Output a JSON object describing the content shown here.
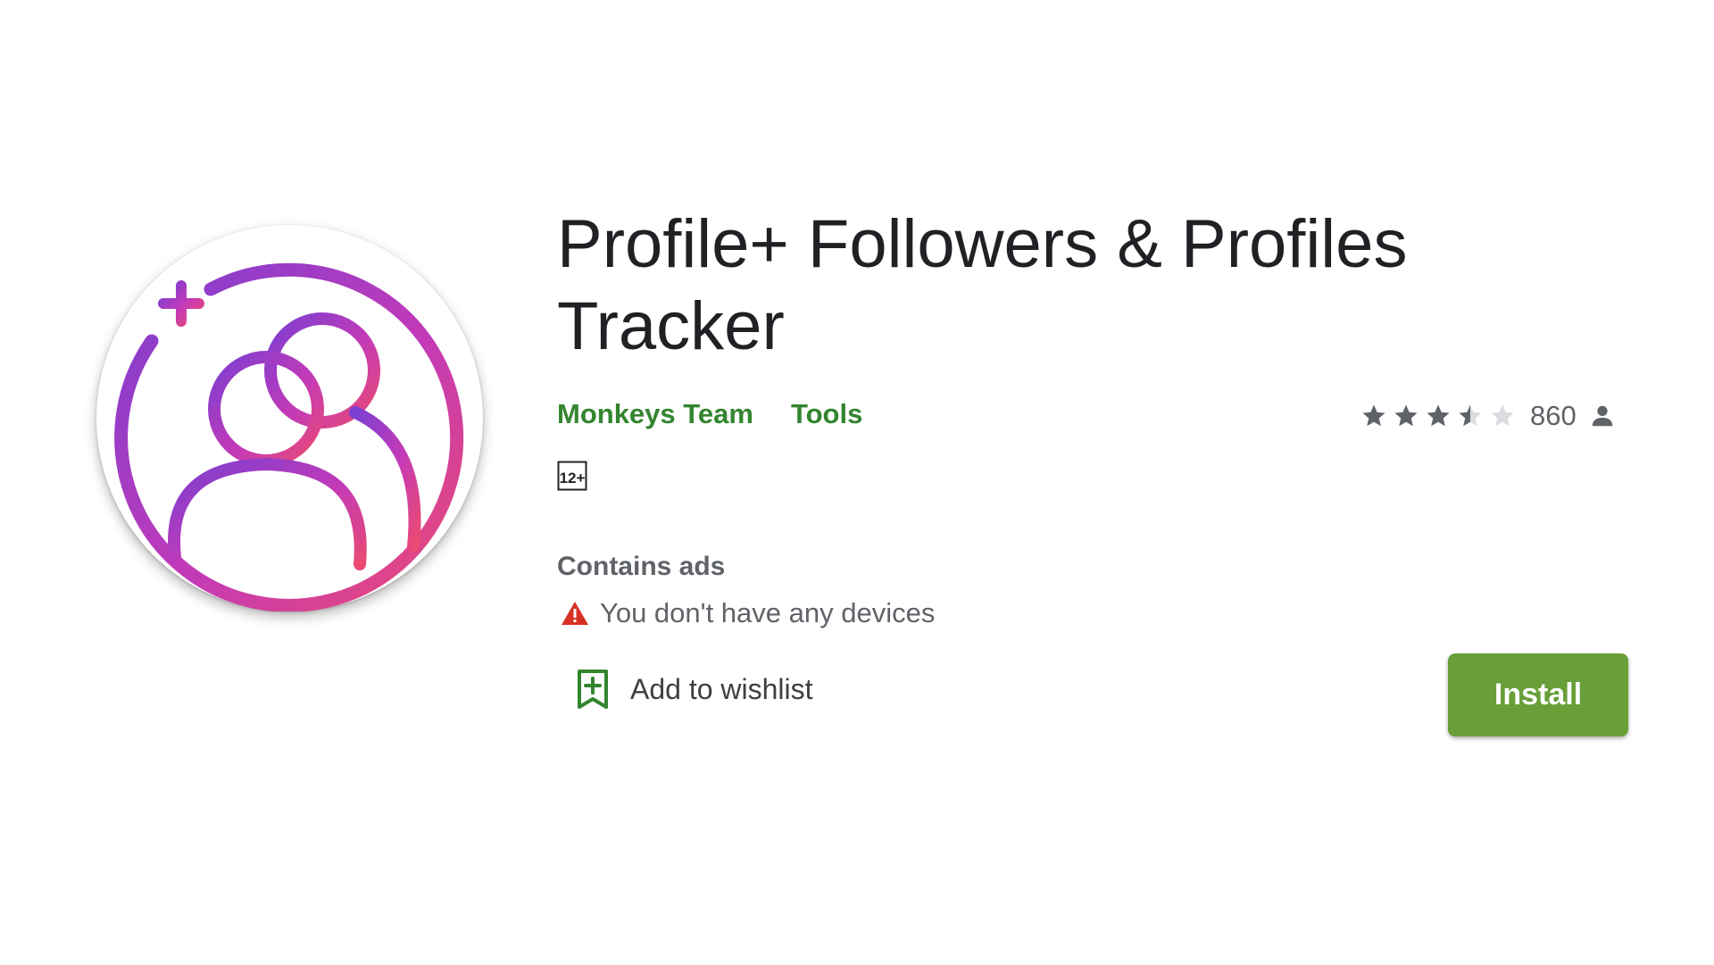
{
  "app": {
    "title": "Profile+ Followers & Profiles Tracker",
    "developer": "Monkeys Team",
    "category": "Tools",
    "content_rating": "12+",
    "ads_notice": "Contains ads",
    "device_warning": "You don't have any devices",
    "wishlist_label": "Add to wishlist",
    "install_label": "Install"
  },
  "rating": {
    "stars_filled": 3.5,
    "stars_total": 5,
    "count": "860"
  },
  "icons": {
    "app_logo": "profile-plus-logo",
    "rating": "star-icon",
    "rating_count": "person-icon",
    "warning": "warning-triangle-icon",
    "wishlist": "bookmark-plus-icon"
  },
  "colors": {
    "accent_green": "#33852f",
    "install_green": "#689f38",
    "warning_red": "#d93025",
    "logo_gradient_start": "#7b3fd1",
    "logo_gradient_end": "#ea4a73"
  }
}
